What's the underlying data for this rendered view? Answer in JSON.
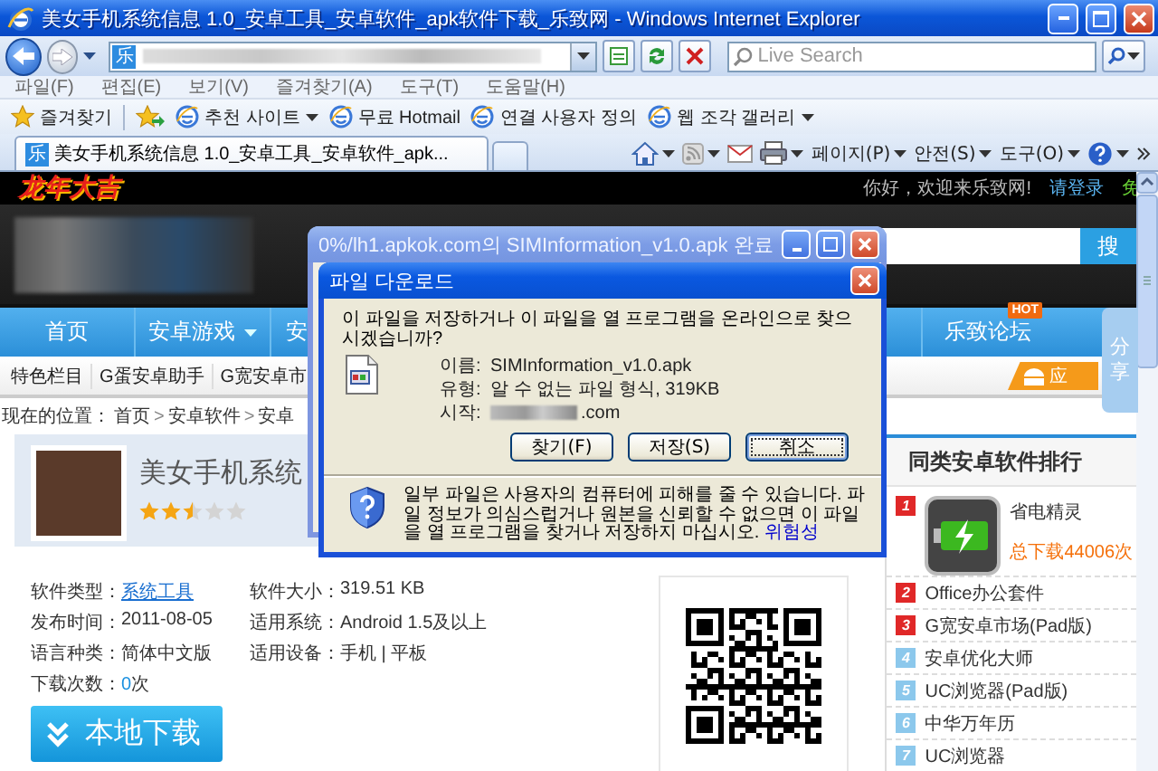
{
  "window": {
    "title": "美女手机系统信息 1.0_安卓工具_安卓软件_apk软件下载_乐致网 - Windows Internet Explorer"
  },
  "address_bar": {
    "site_icon": "乐",
    "search_placeholder": "Live Search"
  },
  "menu_bar": [
    "파일(F)",
    "편집(E)",
    "보기(V)",
    "즐겨찾기(A)",
    "도구(T)",
    "도움말(H)"
  ],
  "favorites_bar": {
    "favorites_button": "즐겨찾기",
    "links": [
      {
        "label": "추천 사이트",
        "dropdown": true
      },
      {
        "label": "무료 Hotmail",
        "dropdown": false
      },
      {
        "label": "연결 사용자 정의",
        "dropdown": false
      },
      {
        "label": "웹 조각 갤러리",
        "dropdown": true
      }
    ]
  },
  "tabs": [
    {
      "icon": "乐",
      "label": "美女手机系统信息 1.0_安卓工具_安卓软件_apk...",
      "selected": true
    }
  ],
  "command_bar": [
    "페이지(P)",
    "안전(S)",
    "도구(O)"
  ],
  "page": {
    "top_bar": {
      "logo": "龙年大吉",
      "greeting": "你好，欢迎来乐致网!",
      "login": "请登录",
      "cut_link": "免"
    },
    "search_button": "搜",
    "nav": {
      "left": [
        {
          "label": "首页",
          "dropdown": false
        },
        {
          "label": "安卓游戏",
          "dropdown": true
        },
        {
          "label": "安",
          "dropdown": false
        }
      ],
      "right": [
        {
          "label": "乐致论坛",
          "badge": "HOT"
        }
      ]
    },
    "subnav": [
      "特色栏目",
      "G蛋安卓助手",
      "G宽安卓市"
    ],
    "app_badge": "应",
    "share_tab": "分享",
    "breadcrumb": {
      "items": [
        "现在的位置：",
        "首页",
        "安卓软件",
        "安卓"
      ],
      "separator": ">"
    },
    "app": {
      "title": "美女手机系统",
      "stars": 2.5
    },
    "details": [
      [
        {
          "kind": "link",
          "label": "软件类型：",
          "value": "系统工具"
        },
        {
          "kind": "text",
          "label": "软件大小：",
          "value": "319.51 KB"
        }
      ],
      [
        {
          "kind": "text",
          "label": "发布时间：",
          "value": "2011-08-05"
        },
        {
          "kind": "text",
          "label": "适用系统：",
          "value": "Android 1.5及以上"
        }
      ],
      [
        {
          "kind": "text",
          "label": "语言种类：",
          "value": "简体中文版"
        },
        {
          "kind": "text",
          "label": "适用设备：",
          "value": "手机 | 平板"
        }
      ],
      [
        {
          "kind": "count",
          "label": "下载次数：",
          "count": "0",
          "unit": "次"
        }
      ]
    ],
    "download_button": "本地下载",
    "ranking": {
      "title": "同类安卓软件排行",
      "items": [
        {
          "kind": "featured",
          "rank": "1",
          "color": "#e02828",
          "name": "省电精灵",
          "downloads": "总下载44006次"
        },
        {
          "kind": "plain",
          "rank": "2",
          "color": "#e02828",
          "name": "Office办公套件"
        },
        {
          "kind": "plain",
          "rank": "3",
          "color": "#e02828",
          "name": "G宽安卓市场(Pad版)"
        },
        {
          "kind": "plain",
          "rank": "4",
          "color": "#8cc8ec",
          "name": "安卓优化大师"
        },
        {
          "kind": "plain",
          "rank": "5",
          "color": "#8cc8ec",
          "name": "UC浏览器(Pad版)"
        },
        {
          "kind": "plain",
          "rank": "6",
          "color": "#8cc8ec",
          "name": "中华万年历"
        },
        {
          "kind": "plain",
          "rank": "7",
          "color": "#8cc8ec",
          "name": "UC浏览器"
        }
      ]
    }
  },
  "progress_window": {
    "title": "0%/lh1.apkok.com의 SIMInformation_v1.0.apk 완료"
  },
  "file_download": {
    "title": "파일 다운로드",
    "question": "이 파일을 저장하거나 이 파일을 열 프로그램을 온라인으로 찾으시겠습니까?",
    "fields": [
      {
        "kind": "plain",
        "label": "이름:",
        "value": "SIMInformation_v1.0.apk"
      },
      {
        "kind": "plain",
        "label": "유형:",
        "value": "알 수 없는 파일 형식, 319KB"
      },
      {
        "kind": "masked",
        "label": "시작:",
        "value": ".com"
      }
    ],
    "buttons": [
      {
        "label": "찾기(F)",
        "focused": false
      },
      {
        "label": "저장(S)",
        "focused": false
      },
      {
        "label": "취소",
        "focused": true
      }
    ],
    "warning": "일부 파일은 사용자의 컴퓨터에 피해를 줄 수 있습니다. 파일 정보가 의심스럽거나 원본을 신뢰할 수 없으면 이 파일을 열 프로그램을 찾거나 저장하지 마십시오.",
    "warning_link": "위험성"
  }
}
